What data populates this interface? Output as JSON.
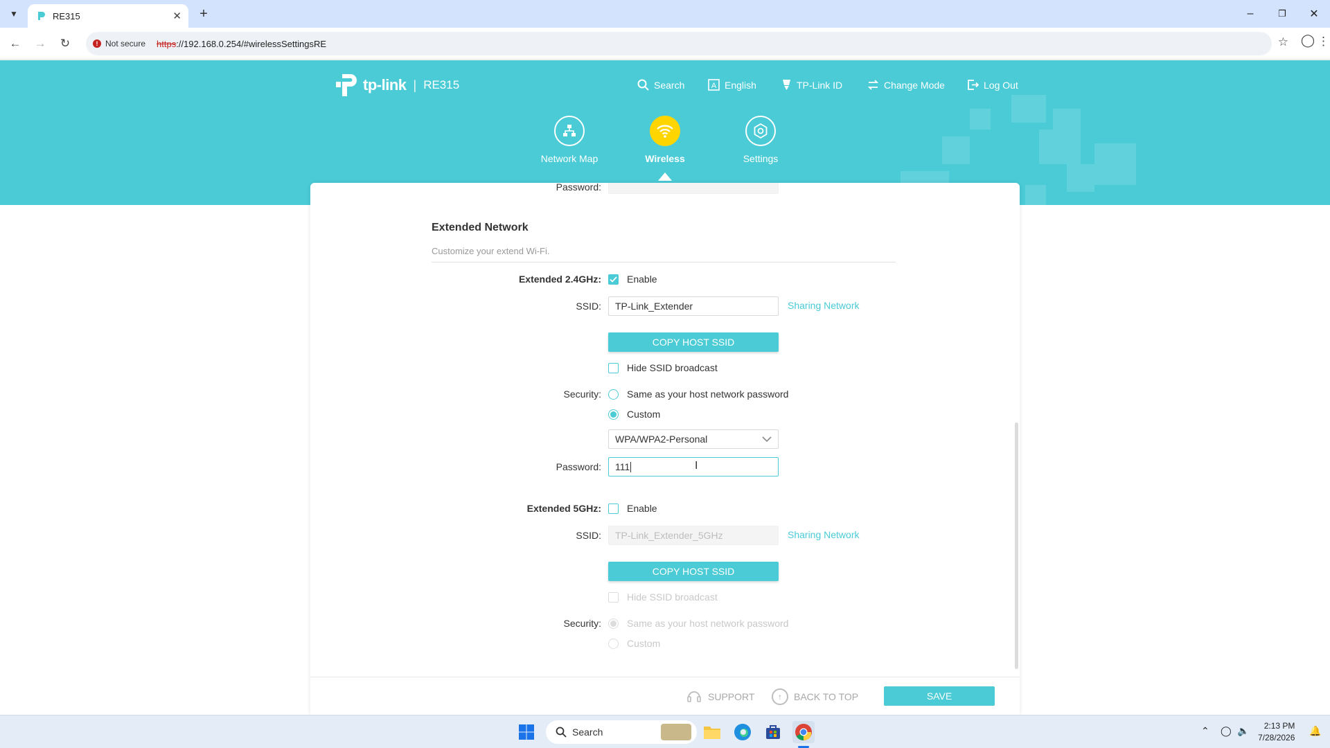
{
  "browser": {
    "tab_title": "RE315",
    "security_label": "Not secure",
    "url_scheme": "https",
    "url_rest": "://192.168.0.254/#wirelessSettingsRE"
  },
  "header": {
    "brand": "tp-link",
    "model": "RE315",
    "nav": {
      "search": "Search",
      "language": "English",
      "tplink_id": "TP-Link ID",
      "change_mode": "Change Mode",
      "logout": "Log Out"
    },
    "tabs": {
      "network_map": "Network Map",
      "wireless": "Wireless",
      "settings": "Settings"
    }
  },
  "content": {
    "cut_password_label": "Password:",
    "section_title": "Extended Network",
    "section_subtitle": "Customize your extend Wi-Fi.",
    "band24": {
      "label": "Extended 2.4GHz:",
      "enable_label": "Enable",
      "enabled": true,
      "ssid_label": "SSID:",
      "ssid_value": "TP-Link_Extender",
      "sharing_link": "Sharing Network",
      "copy_button": "COPY HOST SSID",
      "hide_ssid_label": "Hide SSID broadcast",
      "security_label": "Security:",
      "security_option_same": "Same as your host network password",
      "security_option_custom": "Custom",
      "security_selected": "Custom",
      "encryption": "WPA/WPA2-Personal",
      "password_label": "Password:",
      "password_value": "111"
    },
    "band5": {
      "label": "Extended 5GHz:",
      "enable_label": "Enable",
      "enabled": false,
      "ssid_label": "SSID:",
      "ssid_placeholder": "TP-Link_Extender_5GHz",
      "sharing_link": "Sharing Network",
      "copy_button": "COPY HOST SSID",
      "hide_ssid_label": "Hide SSID broadcast",
      "security_label": "Security:",
      "security_option_same": "Same as your host network password",
      "security_option_custom": "Custom",
      "security_selected": "Same as your host network password"
    }
  },
  "footer": {
    "support": "SUPPORT",
    "back_to_top": "BACK TO TOP",
    "save": "SAVE"
  },
  "taskbar": {
    "search_placeholder": "Search",
    "time": "2:13 PM",
    "date": "7/28/2026"
  },
  "colors": {
    "accent": "#4acbd6",
    "active_tab": "#ffd500"
  }
}
